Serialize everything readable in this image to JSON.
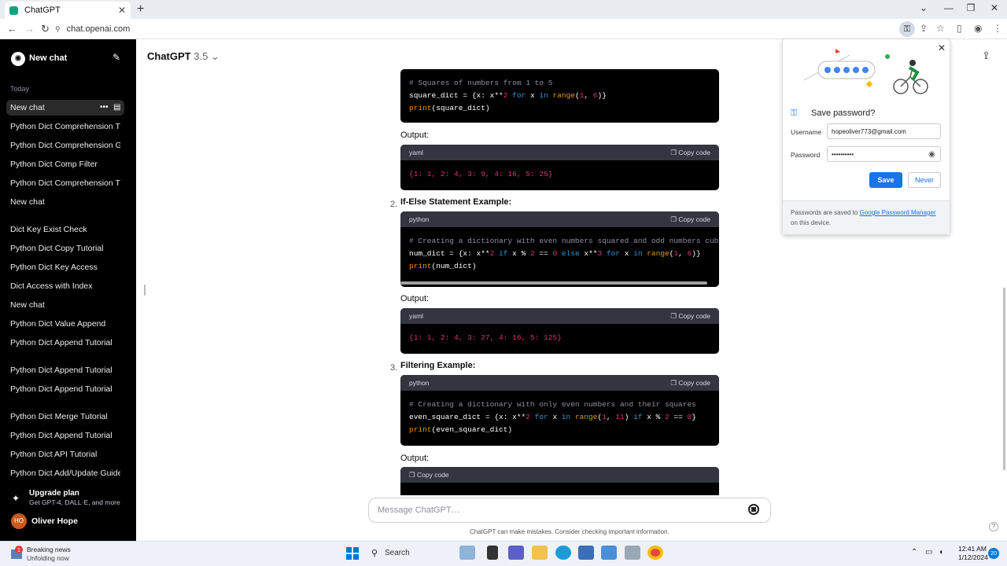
{
  "browser": {
    "tab_title": "ChatGPT",
    "url": "chat.openai.com"
  },
  "sidebar": {
    "new_chat_label": "New chat",
    "section_today": "Today",
    "items": [
      {
        "label": "New chat",
        "active": true
      },
      {
        "label": "Python Dict Comprehension Tutor"
      },
      {
        "label": "Python Dict Comprehension Guid"
      },
      {
        "label": "Python Dict Comp Filter"
      },
      {
        "label": "Python Dict Comprehension Tutor"
      },
      {
        "label": "New chat"
      },
      {
        "label": "Dict Key Exist Check"
      },
      {
        "label": "Python Dict Copy Tutorial"
      },
      {
        "label": "Python Dict Key Access"
      },
      {
        "label": "Dict Access with Index"
      },
      {
        "label": "New chat"
      },
      {
        "label": "Python Dict Value Append"
      },
      {
        "label": "Python Dict Append Tutorial"
      },
      {
        "label": "Python Dict Append Tutorial"
      },
      {
        "label": "Python Dict Append Tutorial"
      },
      {
        "label": "Python Dict Merge Tutorial"
      },
      {
        "label": "Python Dict Append Tutorial"
      },
      {
        "label": "Python Dict API Tutorial"
      },
      {
        "label": "Python Dict Add/Update Guide"
      }
    ],
    "upgrade_title": "Upgrade plan",
    "upgrade_sub": "Get GPT-4, DALL·E, and more",
    "user_initials": "HO",
    "user_name": "Oliver Hope"
  },
  "main": {
    "model_name": "ChatGPT",
    "model_version": "3.5",
    "copy_label": "Copy code",
    "output_label": "Output:",
    "code1_line1": "# Squares of numbers from 1 to 5",
    "code1_line2": "square_dict = {x: x**2 for x in range(1, 6)}",
    "code1_line3": "print(square_dict)",
    "yaml_label": "yaml",
    "python_label": "python",
    "out1": "{1: 1, 2: 4, 3: 9, 4: 16, 5: 25}",
    "h2_num": "2.",
    "h2": "If-Else Statement Example:",
    "code2_line1": "# Creating a dictionary with even numbers squared and odd numbers cube",
    "code2_line2": "num_dict = {x: x**2 if x % 2 == 0 else x**3 for x in range(1, 6)}",
    "code2_line3": "print(num_dict)",
    "out2": "{1: 1, 2: 4, 3: 27, 4: 16, 5: 125}",
    "h3_num": "3.",
    "h3": "Filtering Example:",
    "code3_line1": "# Creating a dictionary with only even numbers and their squares",
    "code3_line2": "even_square_dict = {x: x**2 for x in range(1, 11) if x % 2 == 0}",
    "code3_line3": "print(even_square_dict)",
    "message_placeholder": "Message ChatGPT…",
    "disclaimer": "ChatGPT can make mistakes. Consider checking important information."
  },
  "password_popup": {
    "title": "Save password?",
    "username_label": "Username",
    "username_value": "hopeoliver773@gmail.com",
    "password_label": "Password",
    "password_value": "••••••••••",
    "save_label": "Save",
    "never_label": "Never",
    "footer_text": "Passwords are saved to",
    "footer_link": "Google Password Manager",
    "footer_text2": "on this device."
  },
  "taskbar": {
    "news_title": "Breaking news",
    "news_sub": "Unfolding now",
    "news_badge": "1",
    "search_label": "Search",
    "time": "12:41 AM",
    "date": "1/12/2024",
    "notif_count": "20"
  }
}
